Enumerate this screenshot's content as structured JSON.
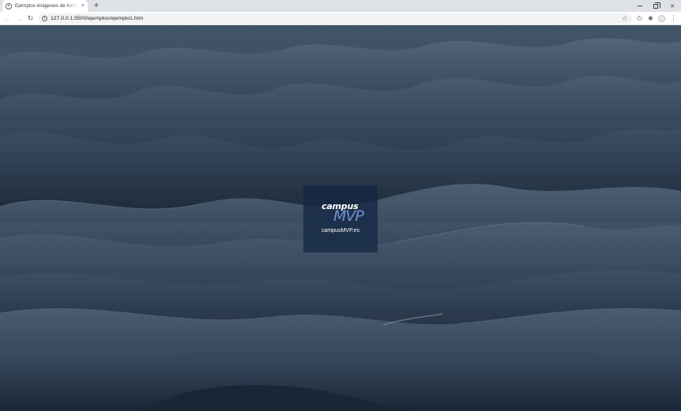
{
  "browser": {
    "tab": {
      "title": "Ejemplos imágenes de fondo m",
      "favicon": "globe-icon",
      "close_glyph": "×"
    },
    "new_tab_glyph": "+",
    "window_controls": {
      "close_glyph": "✕"
    },
    "toolbar": {
      "back_glyph": "←",
      "forward_glyph": "→",
      "reload_glyph": "↻",
      "info_glyph": "i",
      "url": "127.0.0.1:5500/ejemplos/ejemplo1.htm",
      "bookmark_glyph": "☆",
      "extension1_glyph": "⏻",
      "extension2_glyph": "✱",
      "menu_glyph": "⋮"
    }
  },
  "page": {
    "background": {
      "description_icon": "mountain-landscape-image",
      "dominant_color": "#2c3e50"
    },
    "logo": {
      "word": "campus",
      "mark": "MVP",
      "caption": "campusMVP.es",
      "mark_color": "#6e8fd0"
    }
  }
}
